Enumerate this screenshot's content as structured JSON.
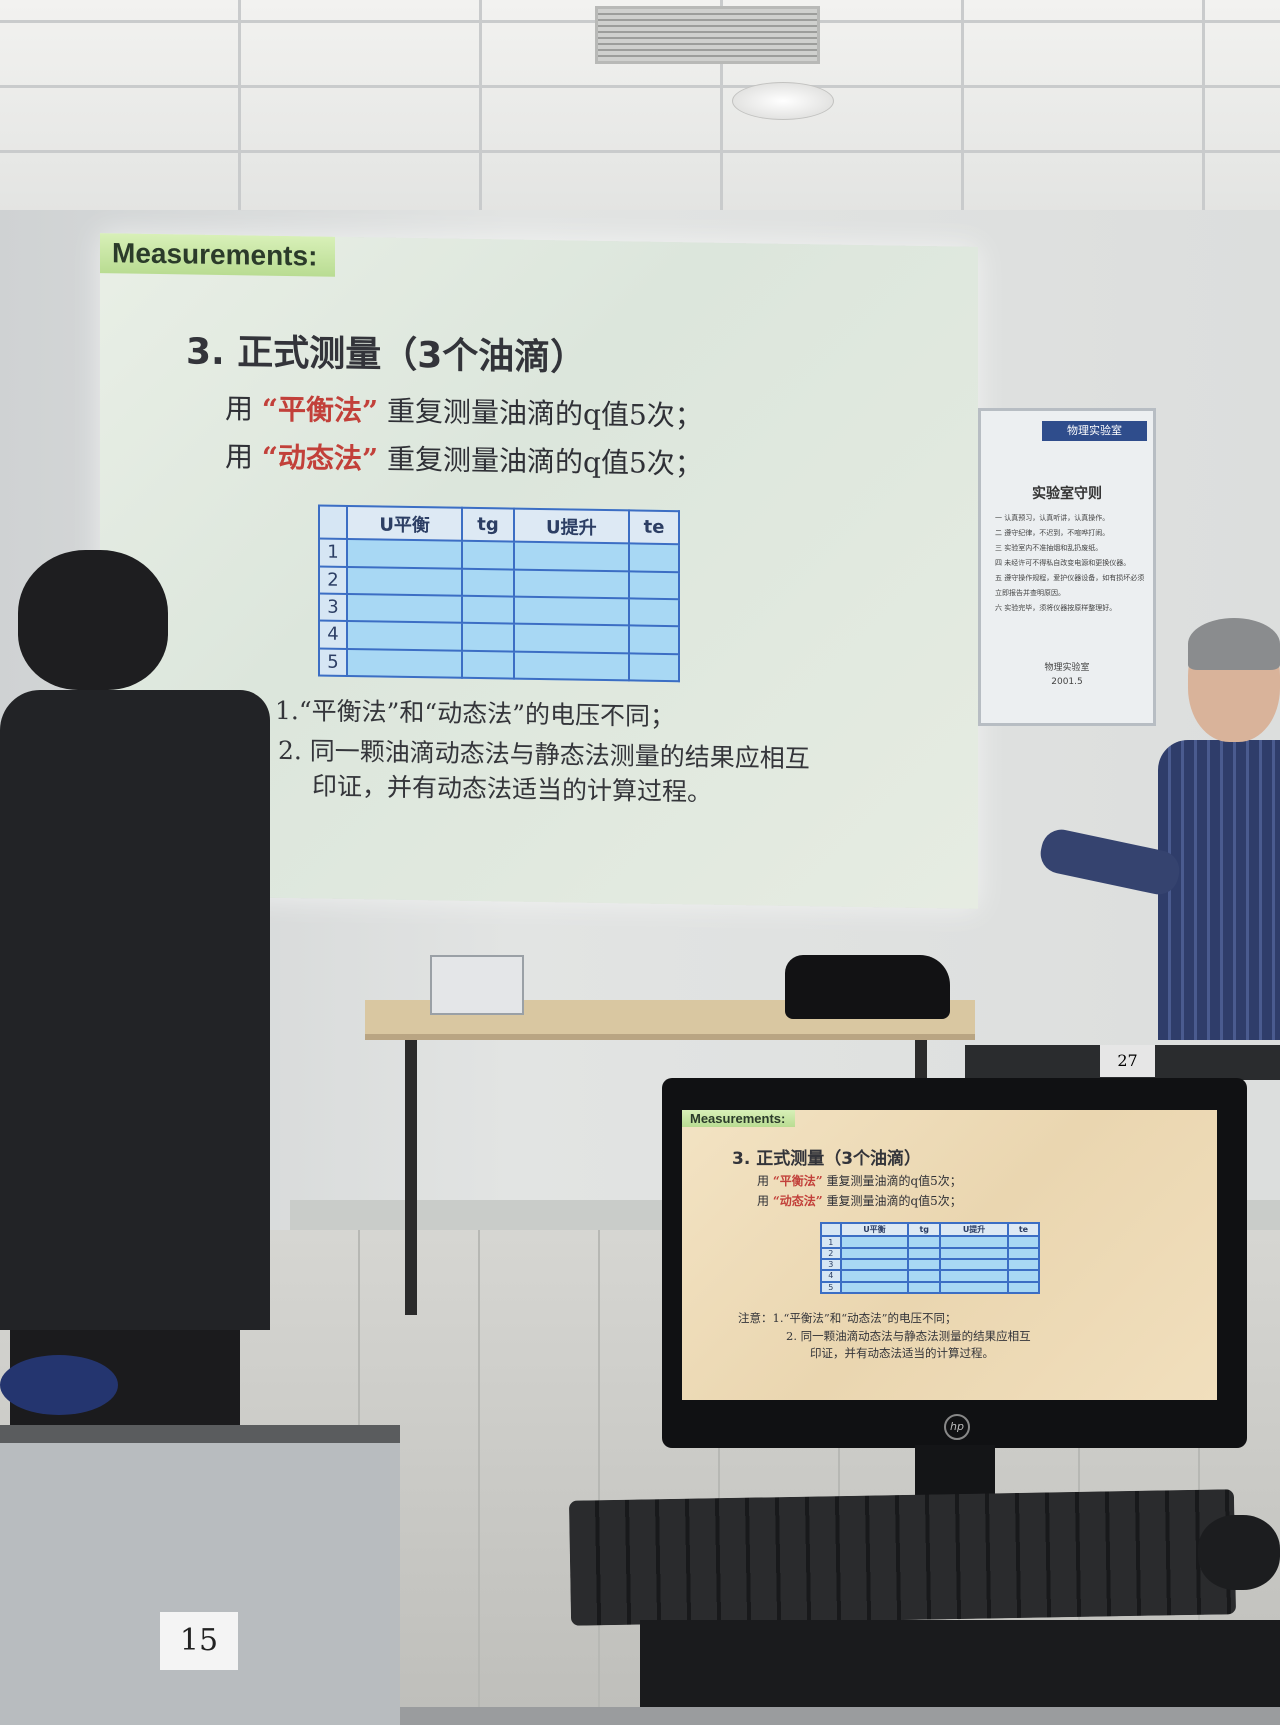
{
  "slide": {
    "header": "Measurements:",
    "title": "3. 正式测量（3个油滴）",
    "line1": {
      "prefix": "用",
      "highlight": "“平衡法”",
      "rest": "重复测量油滴的q值5次；"
    },
    "line2": {
      "prefix": "用",
      "highlight": "“动态法”",
      "rest": "重复测量油滴的q值5次；"
    },
    "table": {
      "headers": [
        "",
        "U平衡",
        "tg",
        "U提升",
        "te"
      ],
      "rows": [
        "1",
        "2",
        "3",
        "4",
        "5"
      ]
    },
    "note1": "意：1.“平衡法”和“动态法”的电压不同；",
    "note2": "2. 同一颗油滴动态法与静态法测量的结果应相互",
    "note3": "印证，并有动态法适当的计算过程。"
  },
  "monitor_slide": {
    "note1": "注意：1.“平衡法”和“动态法”的电压不同；"
  },
  "board": {
    "header": "物理实验室",
    "title": "实验室守则",
    "rules": [
      "一 认真预习，认真听讲，认真操作。",
      "二 遵守纪律，不迟到，不喧哗打闹。",
      "三 实验室内不准抽烟和乱扔废纸。",
      "四 未经许可不得私自改变电源和更换仪器。",
      "五 遵守操作规程，爱护仪器设备，如有损坏必须立即报告并查明原因。",
      "六 实验完毕，须将仪器按原样整理好。"
    ],
    "footer_org": "物理实验室",
    "footer_date": "2001.5"
  },
  "desk_numbers": {
    "front": "15",
    "right": "27"
  },
  "monitor_brand": "hp",
  "colors": {
    "highlight_red": "#c2403a",
    "table_blue": "#a8d8f4",
    "label_green": "#c6e6a0"
  }
}
